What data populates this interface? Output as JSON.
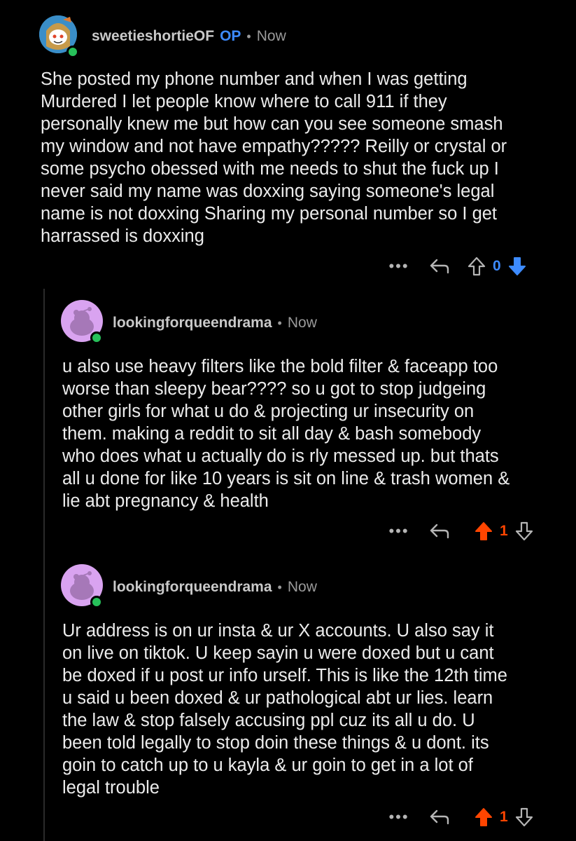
{
  "comments": [
    {
      "username": "sweetieshortieOF",
      "op_label": "OP",
      "separator": "•",
      "time": "Now",
      "text": "She posted my phone number and when I was getting\nMurdered I let people know where to call 911 if they\npersonally knew me but how can you see someone smash\nmy window and not have empathy????? Reilly or crystal or\nsome psycho obessed with me needs to shut the fuck up I\nnever said my name was doxxing saying someone's legal\nname is not doxxing Sharing my personal number so I get\nharrassed is doxxing",
      "more_label": "•••",
      "vote_count": "0",
      "vote_state": "downvoted",
      "count_color": "#3d8bff"
    },
    {
      "username": "lookingforqueendrama",
      "separator": "•",
      "time": "Now",
      "text": "u also use heavy filters like the bold filter & faceapp too\nworse than sleepy bear???? so u got to stop judgeing\nother girls for what u do & projecting ur insecurity on\nthem. making a reddit to sit all day & bash somebody\nwho does what u actually do is rly messed up. but thats\nall u done for like 10 years is sit on line & trash women &\nlie abt pregnancy & health",
      "more_label": "•••",
      "vote_count": "1",
      "vote_state": "upvoted",
      "count_color": "#ff4500"
    },
    {
      "username": "lookingforqueendrama",
      "separator": "•",
      "time": "Now",
      "text": "Ur address is on ur insta & ur X accounts. U also say it\non live on tiktok. U keep sayin u were doxed but u cant\nbe doxed if u post ur info urself. This is like the 12th time\nu said u been doxed & ur pathological abt ur lies. learn\nthe law & stop falsely accusing ppl cuz its all u do. U\nbeen told legally to stop doin these things & u dont. its\ngoin to catch up to u kayla & ur goin to get in a lot of\nlegal trouble",
      "more_label": "•••",
      "vote_count": "1",
      "vote_state": "upvoted",
      "count_color": "#ff4500"
    }
  ],
  "colors": {
    "background": "#000000",
    "upvote": "#ff4500",
    "downvote": "#3d8bff",
    "online": "#27c05a"
  },
  "icons": [
    "more-icon",
    "reply-icon",
    "upvote-icon",
    "downvote-icon",
    "avatar-snoo"
  ]
}
